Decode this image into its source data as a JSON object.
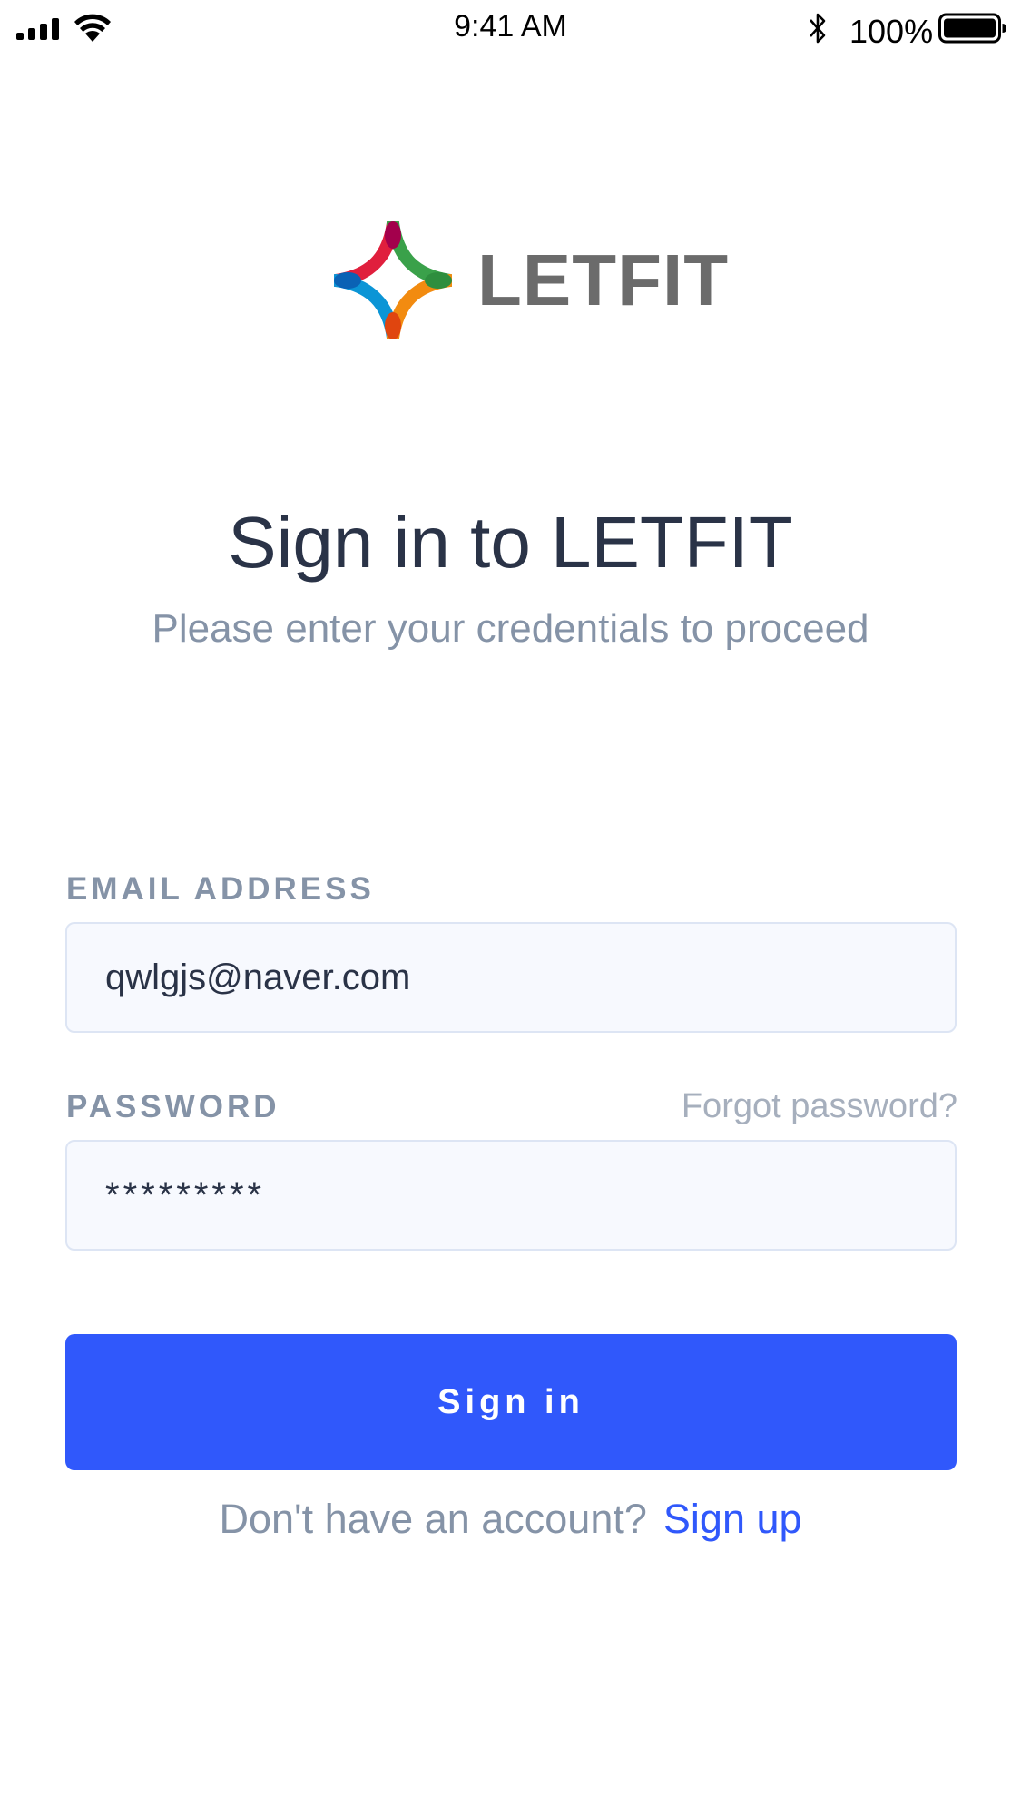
{
  "status_bar": {
    "time": "9:41 AM",
    "battery_percent": "100%",
    "icons": [
      "signal-icon",
      "wifi-icon",
      "bluetooth-icon",
      "battery-icon"
    ]
  },
  "logo": {
    "text": "LETFIT",
    "icon": "letfit-star-logo",
    "colors": [
      "#a3004c",
      "#e01f3d",
      "#2e8e3e",
      "#3aa14a",
      "#0a62b5",
      "#0b95d6",
      "#e0450f",
      "#f28b10"
    ]
  },
  "header": {
    "title": "Sign in to LETFIT",
    "subtitle": "Please enter your credentials to proceed"
  },
  "form": {
    "email_label": "EMAIL ADDRESS",
    "email_value": "qwlgjs@naver.com",
    "password_label": "PASSWORD",
    "password_value": "*********",
    "forgot_password": "Forgot password?",
    "submit_label": "Sign in"
  },
  "footer": {
    "prompt": "Don't have an account?",
    "signup_link": "Sign up"
  },
  "colors": {
    "accent": "#3058fb",
    "title_text": "#2a3347",
    "muted_text": "#8593a7",
    "input_background": "#f7f9fe",
    "input_border": "#dde5f4"
  }
}
